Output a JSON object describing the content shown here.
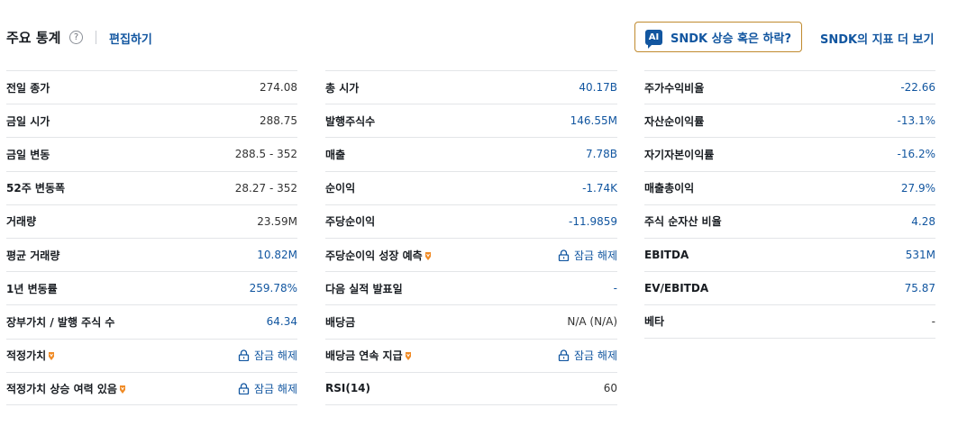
{
  "header": {
    "title": "주요 통계",
    "help_icon_glyph": "?",
    "edit_link": "편집하기",
    "ai_badge": "AI",
    "ai_button_label": "SNDK 상승 혹은 하락?",
    "more_link": "SNDK의 지표 더 보기"
  },
  "colors": {
    "link_blue": "#1256a0",
    "premium_orange": "#f08a24",
    "ai_border": "#c08a2e"
  },
  "columns": [
    {
      "rows": [
        {
          "label": "전일 종가",
          "value": "274.08",
          "blue": false,
          "premium": false,
          "locked": false
        },
        {
          "label": "금일 시가",
          "value": "288.75",
          "blue": false,
          "premium": false,
          "locked": false
        },
        {
          "label": "금일 변동",
          "value": "288.5 - 352",
          "blue": false,
          "premium": false,
          "locked": false
        },
        {
          "label": "52주 변동폭",
          "value": "28.27 - 352",
          "blue": false,
          "premium": false,
          "locked": false
        },
        {
          "label": "거래량",
          "value": "23.59M",
          "blue": false,
          "premium": false,
          "locked": false
        },
        {
          "label": "평균 거래량",
          "value": "10.82M",
          "blue": true,
          "premium": false,
          "locked": false
        },
        {
          "label": "1년 변동률",
          "value": "259.78%",
          "blue": true,
          "premium": false,
          "locked": false
        },
        {
          "label": "장부가치 / 발행 주식 수",
          "value": "64.34",
          "blue": true,
          "premium": false,
          "locked": false
        },
        {
          "label": "적정가치",
          "value": "잠금 해제",
          "blue": true,
          "premium": true,
          "locked": true
        },
        {
          "label": "적정가치 상승 여력 있음",
          "value": "잠금 해제",
          "blue": true,
          "premium": true,
          "locked": true
        }
      ]
    },
    {
      "rows": [
        {
          "label": "총 시가",
          "value": "40.17B",
          "blue": true,
          "premium": false,
          "locked": false
        },
        {
          "label": "발행주식수",
          "value": "146.55M",
          "blue": true,
          "premium": false,
          "locked": false
        },
        {
          "label": "매출",
          "value": "7.78B",
          "blue": true,
          "premium": false,
          "locked": false
        },
        {
          "label": "순이익",
          "value": "-1.74K",
          "blue": true,
          "premium": false,
          "locked": false
        },
        {
          "label": "주당순이익",
          "value": "-11.9859",
          "blue": true,
          "premium": false,
          "locked": false
        },
        {
          "label": "주당순이익 성장 예측",
          "value": "잠금 해제",
          "blue": true,
          "premium": true,
          "locked": true
        },
        {
          "label": "다음 실적 발표일",
          "value": "-",
          "blue": true,
          "premium": false,
          "locked": false
        },
        {
          "label": "배당금",
          "value": "N/A (N/A)",
          "blue": false,
          "premium": false,
          "locked": false
        },
        {
          "label": "배당금 연속 지급",
          "value": "잠금 해제",
          "blue": true,
          "premium": true,
          "locked": true
        },
        {
          "label": "RSI(14)",
          "value": "60",
          "blue": false,
          "premium": false,
          "locked": false
        }
      ]
    },
    {
      "rows": [
        {
          "label": "주가수익비율",
          "value": "-22.66",
          "blue": true,
          "premium": false,
          "locked": false
        },
        {
          "label": "자산순이익률",
          "value": "-13.1%",
          "blue": true,
          "premium": false,
          "locked": false
        },
        {
          "label": "자기자본이익률",
          "value": "-16.2%",
          "blue": true,
          "premium": false,
          "locked": false
        },
        {
          "label": "매출총이익",
          "value": "27.9%",
          "blue": true,
          "premium": false,
          "locked": false
        },
        {
          "label": "주식 순자산 비율",
          "value": "4.28",
          "blue": true,
          "premium": false,
          "locked": false
        },
        {
          "label": "EBITDA",
          "value": "531M",
          "blue": true,
          "premium": false,
          "locked": false
        },
        {
          "label": "EV/EBITDA",
          "value": "75.87",
          "blue": true,
          "premium": false,
          "locked": false
        },
        {
          "label": "베타",
          "value": "-",
          "blue": false,
          "premium": false,
          "locked": false
        }
      ]
    }
  ]
}
